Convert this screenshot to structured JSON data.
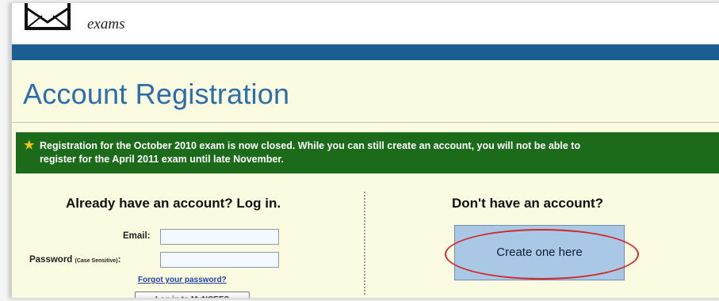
{
  "header": {
    "site_name": "exams",
    "logo_icon": "envelope-logo-icon"
  },
  "page": {
    "title": "Account Registration"
  },
  "notice": {
    "icon": "star-icon",
    "line1": "Registration for the October 2010 exam is now closed. While you can still create an account, you will not be able to",
    "line2": "register for the April 2011 exam until late November."
  },
  "login": {
    "heading": "Already have an account? Log in.",
    "email_label": "Email:",
    "email_value": "",
    "password_label": "Password",
    "password_hint": "(Case Sensitive)",
    "password_colon": ":",
    "password_value": "",
    "forgot_link": "Forgot your password?",
    "button_label": "Log in to MyNCEES"
  },
  "signup": {
    "heading": "Don't have an account?",
    "create_button": "Create one here"
  },
  "colors": {
    "page_bg": "#fbfbe2",
    "blue_bar": "#1a5e92",
    "title": "#2b6ea8",
    "notice_bg": "#1b6b1b",
    "star": "#f3c212",
    "create_button_bg": "#a9c8e6",
    "annotation_ellipse": "#d22a2a"
  }
}
